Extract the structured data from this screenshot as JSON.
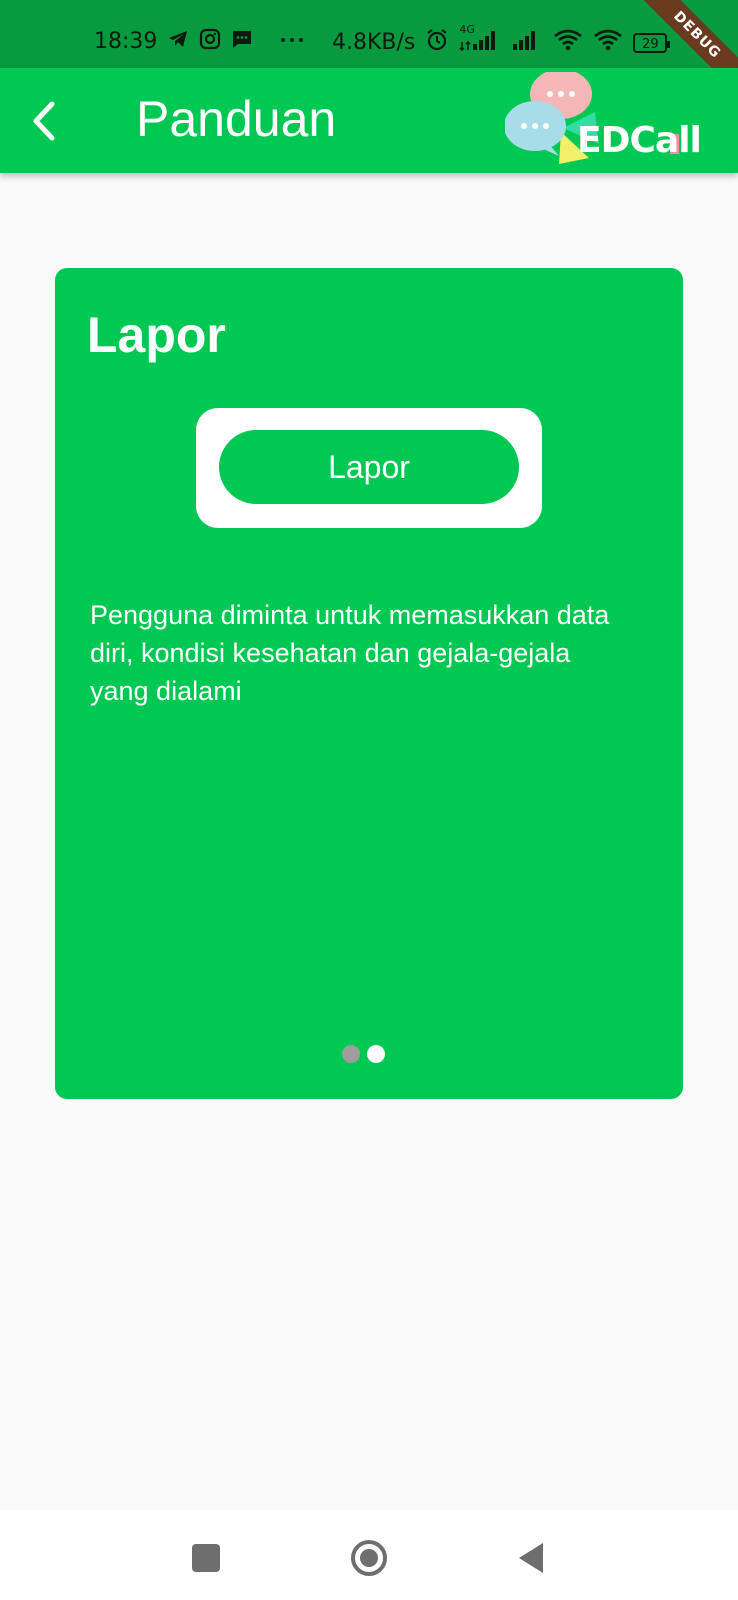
{
  "status_bar": {
    "time": "18:39",
    "net_speed": "4.8KB/s",
    "network_type": "4G",
    "battery": "29",
    "icons": [
      "telegram-icon",
      "instagram-icon",
      "message-icon",
      "more-icon",
      "alarm-icon",
      "signal-icon",
      "signal-icon",
      "wifi-icon",
      "wifi-icon",
      "battery-icon"
    ]
  },
  "debug_banner": "DEBUG",
  "app_bar": {
    "title": "Panduan",
    "brand": "EDCall"
  },
  "card": {
    "title": "Lapor",
    "demo_button_label": "Lapor",
    "description": "Pengguna diminta untuk memasukkan data diri, kondisi kesehatan dan gejala-gejala yang dialami",
    "page_indicator": {
      "total": 2,
      "active": 2
    }
  },
  "colors": {
    "primary": "#00c853",
    "status_bar": "#079a3e",
    "background": "#f9f9f9",
    "dot_inactive": "#9e9e9e"
  },
  "nav_bar": {
    "icons": [
      "recents-square-icon",
      "home-circle-icon",
      "back-triangle-icon"
    ]
  }
}
